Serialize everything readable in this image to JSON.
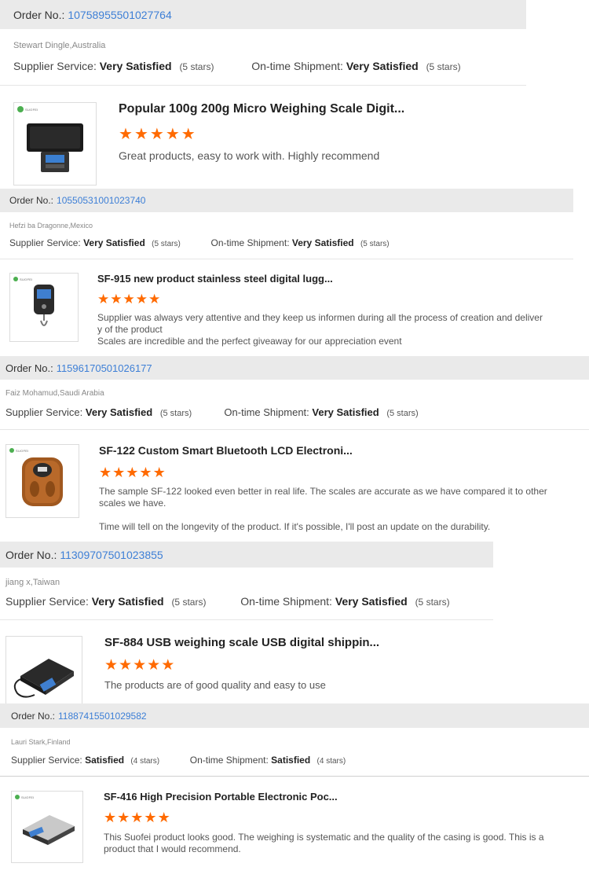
{
  "reviews": [
    {
      "order_label": "Order No.:",
      "order_no": "10758955501027764",
      "author": "Stewart Dingle,Australia",
      "supplier_label": "Supplier Service:",
      "supplier_value": "Very Satisfied",
      "supplier_stars": "(5 stars)",
      "shipment_label": "On-time Shipment:",
      "shipment_value": "Very Satisfied",
      "shipment_stars": "(5 stars)",
      "product_title": "Popular 100g 200g Micro Weighing Scale Digit...",
      "rating": 5,
      "text": [
        "Great products, easy to work with. Highly recommend"
      ]
    },
    {
      "order_label": "Order No.:",
      "order_no": "10550531001023740",
      "author": "Hefzi ba Dragonne,Mexico",
      "supplier_label": "Supplier Service:",
      "supplier_value": "Very Satisfied",
      "supplier_stars": "(5 stars)",
      "shipment_label": "On-time Shipment:",
      "shipment_value": "Very Satisfied",
      "shipment_stars": "(5 stars)",
      "product_title": "SF-915 new product stainless steel digital lugg...",
      "rating": 5,
      "text": [
        "Supplier was always very attentive and they keep us informen during all the process of creation and deliver",
        "y of the product",
        "Scales are incredible and the perfect giveaway for our appreciation event"
      ]
    },
    {
      "order_label": "Order No.:",
      "order_no": "11596170501026177",
      "author": "Faiz Mohamud,Saudi Arabia",
      "supplier_label": "Supplier Service:",
      "supplier_value": "Very Satisfied",
      "supplier_stars": "(5 stars)",
      "shipment_label": "On-time Shipment:",
      "shipment_value": "Very Satisfied",
      "shipment_stars": "(5 stars)",
      "product_title": "SF-122 Custom Smart Bluetooth LCD Electroni...",
      "rating": 5,
      "text": [
        "The sample SF-122 looked even better in real life. The scales are accurate as we have compared it to other",
        "scales we have.",
        "",
        "Time will tell on the longevity of the product. If it's possible, I'll post an update on the durability."
      ]
    },
    {
      "order_label": "Order No.:",
      "order_no": "11309707501023855",
      "author": "jiang x,Taiwan",
      "supplier_label": "Supplier Service:",
      "supplier_value": "Very Satisfied",
      "supplier_stars": "(5 stars)",
      "shipment_label": "On-time Shipment:",
      "shipment_value": "Very Satisfied",
      "shipment_stars": "(5 stars)",
      "product_title": "SF-884 USB weighing scale USB digital shippin...",
      "rating": 5,
      "text": [
        "The products are of good quality and easy to use"
      ]
    },
    {
      "order_label": "Order No.:",
      "order_no": "11887415501029582",
      "author": "Lauri Stark,Finland",
      "supplier_label": "Supplier Service:",
      "supplier_value": "Satisfied",
      "supplier_stars": "(4 stars)",
      "shipment_label": "On-time Shipment:",
      "shipment_value": "Satisfied",
      "shipment_stars": "(4 stars)",
      "product_title": "SF-416 High Precision Portable Electronic Poc...",
      "rating": 5,
      "text": [
        "This Suofei product looks good. The weighing is systematic and the quality of the casing is good. This is a",
        "product that I would recommend."
      ]
    }
  ],
  "star_glyph": "★",
  "colors": {
    "star": "#ff6a00",
    "order_link": "#3d7fd6",
    "order_bar_bg": "#eaeaea"
  }
}
